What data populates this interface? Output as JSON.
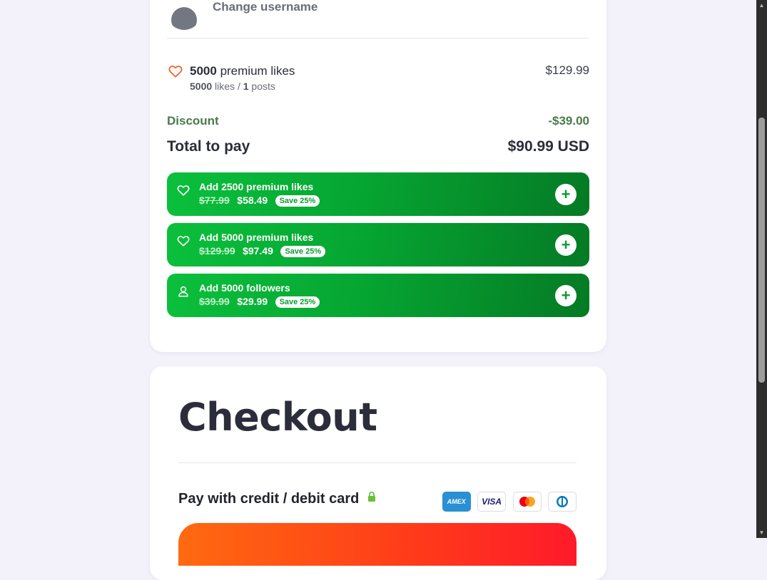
{
  "profile": {
    "change_username_label": "Change username"
  },
  "order": {
    "item": {
      "quantity": "5000",
      "title_suffix": "premium likes",
      "sub_likes": "5000",
      "sub_likes_label": "likes /",
      "sub_posts": "1",
      "sub_posts_label": "posts",
      "price": "$129.99",
      "icon": "heart-icon"
    },
    "discount": {
      "label": "Discount",
      "value": "-$39.00"
    },
    "total": {
      "label": "Total to pay",
      "value": "$90.99 USD"
    }
  },
  "upsells": [
    {
      "prefix": "Add",
      "bold": "2500 premium likes",
      "old_price": "$77.99",
      "new_price": "$58.49",
      "save": "Save 25%",
      "icon": "heart-icon"
    },
    {
      "prefix": "Add",
      "bold": "5000 premium likes",
      "old_price": "$129.99",
      "new_price": "$97.49",
      "save": "Save 25%",
      "icon": "heart-icon"
    },
    {
      "prefix": "Add",
      "bold": "5000 followers",
      "old_price": "$39.99",
      "new_price": "$29.99",
      "save": "Save 25%",
      "icon": "user-icon"
    }
  ],
  "upsell_add_symbol": "+",
  "checkout": {
    "title": "Checkout",
    "pay_label": "Pay with credit / debit card",
    "card_brands": [
      "AMEX",
      "VISA",
      "mastercard",
      "diners-club"
    ],
    "amex_label": "AMEX",
    "visa_label": "VISA"
  },
  "colors": {
    "accent_green": "#0bc03c",
    "discount_green": "#4a7a4a",
    "pay_orange": "#ff6a10",
    "lock_green": "#6bbf3a"
  }
}
